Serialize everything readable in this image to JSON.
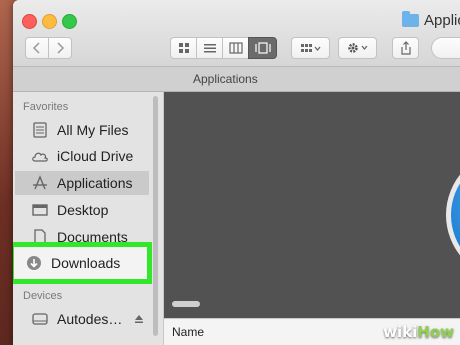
{
  "window": {
    "title": "Applic"
  },
  "toolbar": {
    "back_icon": "chevron-left",
    "forward_icon": "chevron-right",
    "views": [
      "icon-view",
      "list-view",
      "column-view",
      "cover-flow-view"
    ],
    "active_view": "cover-flow-view",
    "arrange_icon": "arrange-grid",
    "action_icon": "gear",
    "share_icon": "share"
  },
  "tab": {
    "label": "Applications"
  },
  "sidebar": {
    "favorites_heading": "Favorites",
    "favorites": [
      {
        "label": "All My Files",
        "icon": "all-files-icon"
      },
      {
        "label": "iCloud Drive",
        "icon": "cloud-icon"
      },
      {
        "label": "Applications",
        "icon": "applications-icon",
        "selected": true
      },
      {
        "label": "Desktop",
        "icon": "desktop-icon"
      },
      {
        "label": "Documents",
        "icon": "documents-icon"
      },
      {
        "label": "Downloads",
        "icon": "downloads-icon",
        "highlighted": true
      }
    ],
    "devices_heading": "Devices",
    "devices": [
      {
        "label": "Autodes…",
        "icon": "disk-icon"
      }
    ]
  },
  "list": {
    "column_name": "Name"
  },
  "colors": {
    "highlight": "#32e62a",
    "content_bg": "#525252"
  },
  "watermark": {
    "prefix": "wiki",
    "suffix": "How"
  }
}
